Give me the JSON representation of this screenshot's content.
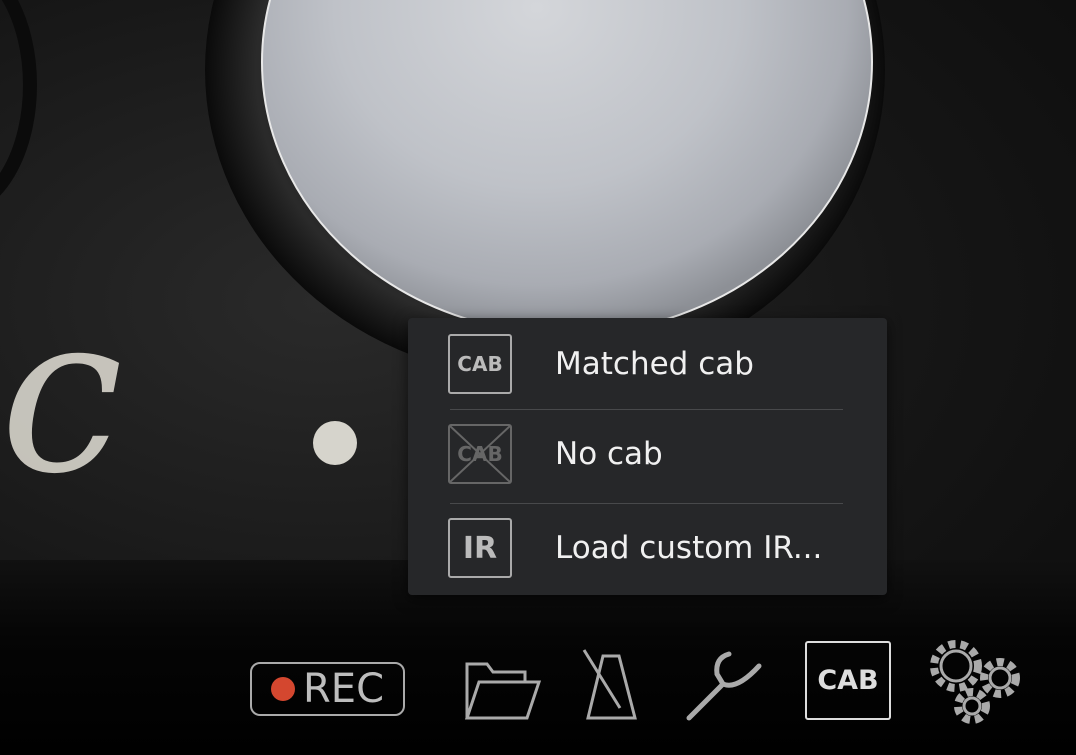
{
  "cab_menu": {
    "items": [
      {
        "icon": "cab-icon",
        "icon_text": "CAB",
        "label": "Matched cab"
      },
      {
        "icon": "no-cab-icon",
        "icon_text": "CAB",
        "label": "No cab"
      },
      {
        "icon": "ir-icon",
        "icon_text": "IR",
        "label": "Load custom IR..."
      }
    ]
  },
  "toolbar": {
    "rec_label": "REC",
    "cab_label": "CAB",
    "icons": [
      "record-icon",
      "folder-icon",
      "metronome-icon",
      "tuning-fork-icon",
      "cab-icon",
      "gears-icon"
    ]
  },
  "background": {
    "script_letter": "c"
  },
  "colors": {
    "record": "#d4472f",
    "menu_bg": "#262729"
  }
}
